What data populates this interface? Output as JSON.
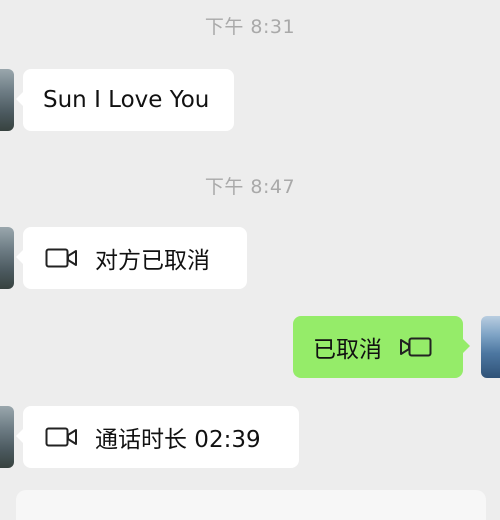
{
  "messages": {
    "time_1": "下午 8:31",
    "msg_1": "Sun I Love You",
    "time_2": "下午 8:47",
    "call_1": "对方已取消",
    "call_2": "已取消",
    "call_3": "通话时长 02:39"
  },
  "icons": {
    "video_call": "video-camera-icon"
  },
  "colors": {
    "background": "#ededed",
    "incoming_bubble": "#ffffff",
    "outgoing_bubble": "#95ec69",
    "timestamp_text": "#a9a9a9"
  }
}
